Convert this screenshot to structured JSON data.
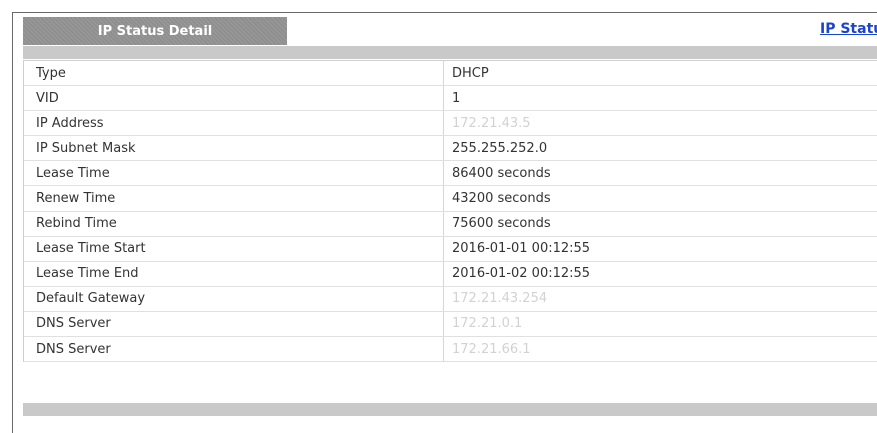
{
  "panel": {
    "tab_title": "IP Status Detail",
    "link_label": "IP Status"
  },
  "rows": [
    {
      "label": "Type",
      "value": "DHCP",
      "faint": false
    },
    {
      "label": "VID",
      "value": "1",
      "faint": false
    },
    {
      "label": "IP Address",
      "value": "172.21.43.5",
      "faint": true
    },
    {
      "label": "IP Subnet Mask",
      "value": "255.255.252.0",
      "faint": false
    },
    {
      "label": "Lease Time",
      "value": "86400 seconds",
      "faint": false
    },
    {
      "label": "Renew Time",
      "value": "43200 seconds",
      "faint": false
    },
    {
      "label": "Rebind Time",
      "value": "75600 seconds",
      "faint": false
    },
    {
      "label": "Lease Time Start",
      "value": "2016-01-01 00:12:55",
      "faint": false
    },
    {
      "label": "Lease Time End",
      "value": "2016-01-02 00:12:55",
      "faint": false
    },
    {
      "label": "Default Gateway",
      "value": "172.21.43.254",
      "faint": true
    },
    {
      "label": "DNS Server",
      "value": "172.21.0.1",
      "faint": true
    },
    {
      "label": "DNS Server",
      "value": "172.21.66.1",
      "faint": true
    }
  ]
}
